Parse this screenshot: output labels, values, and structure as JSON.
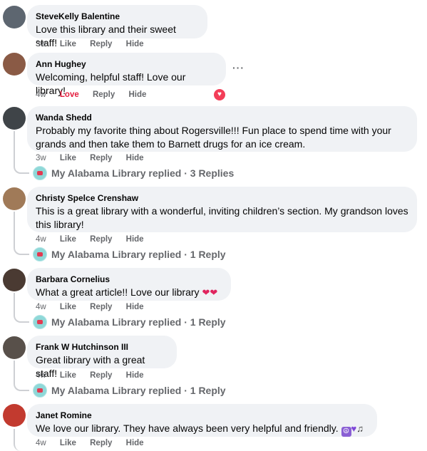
{
  "labels": {
    "like": "Like",
    "love": "Love",
    "reply": "Reply",
    "hide": "Hide"
  },
  "comments": [
    {
      "author": "SteveKelly Balentine",
      "text": "Love this library and their sweet staff!",
      "time": "3w",
      "reaction": "Like"
    },
    {
      "author": "Ann Hughey",
      "text": "Welcoming, helpful staff! Love our library!",
      "time": "4w",
      "reaction": "Love",
      "more": "···",
      "badge": "heart-reaction-icon"
    },
    {
      "author": "Wanda Shedd",
      "text": "Probably my favorite thing about Rogersville!!! Fun place to spend time with your grands and then take them to Barnett drugs for an ice cream.",
      "time": "3w",
      "reaction": "Like",
      "replies": "My Alabama Library replied · 3 Replies"
    },
    {
      "author": "Christy Spelce Crenshaw",
      "text": "This is a great library with a wonderful, inviting children’s section. My grandson loves this library!",
      "time": "4w",
      "reaction": "Like",
      "replies": "My Alabama Library replied · 1 Reply"
    },
    {
      "author": "Barbara Cornelius",
      "text": "What a great article!! Love our library",
      "emojis": [
        "red-heart",
        "red-heart"
      ],
      "time": "4w",
      "reaction": "Like",
      "replies": "My Alabama Library replied · 1 Reply"
    },
    {
      "author": "Frank W Hutchinson III",
      "text": "Great library with a great staff!",
      "time": "4w",
      "reaction": "Like",
      "replies": "My Alabama Library replied · 1 Reply"
    },
    {
      "author": "Janet Romine",
      "text": "We love our library. They have always been very helpful and friendly.",
      "emojis": [
        "peace-icon",
        "purple-heart",
        "music-note"
      ],
      "time": "4w",
      "reaction": "Like"
    }
  ],
  "colors": {
    "bubble": "#f0f2f5",
    "secondary_text": "#65676b",
    "love": "#e41e3f",
    "thread_line": "#ced0d4"
  }
}
